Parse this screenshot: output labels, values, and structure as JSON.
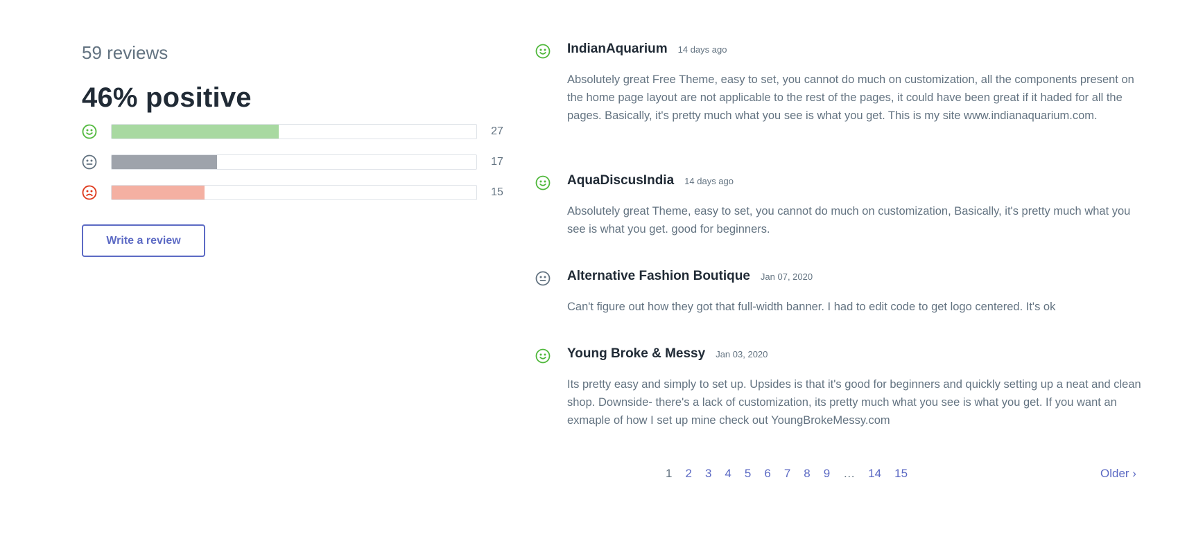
{
  "summary": {
    "review_count": "59 reviews",
    "positive_label": "46% positive",
    "ratings": [
      {
        "sentiment": "positive",
        "icon": "smile-face-icon",
        "count": "27",
        "fraction": 0.4576,
        "color": "#a8d9a1",
        "icon_color": "#50b83c"
      },
      {
        "sentiment": "neutral",
        "icon": "neutral-face-icon",
        "count": "17",
        "fraction": 0.2881,
        "color": "#9ea3ab",
        "icon_color": "#637381"
      },
      {
        "sentiment": "negative",
        "icon": "frown-face-icon",
        "count": "15",
        "fraction": 0.2542,
        "color": "#f4b0a2",
        "icon_color": "#de3618"
      }
    ],
    "write_review_label": "Write a review"
  },
  "reviews": [
    {
      "sentiment": "positive",
      "icon": "smile-face-icon",
      "author": "IndianAquarium",
      "date": "14 days ago",
      "body": "Absolutely great Free Theme, easy to set, you cannot do much on customization, all the components present on the home page layout are not applicable to the rest of the pages, it could have been great if it haded for all the pages. Basically, it's pretty much what you see is what you get. This is my site www.indianaquarium.com."
    },
    {
      "sentiment": "positive",
      "icon": "smile-face-icon",
      "author": "AquaDiscusIndia",
      "date": "14 days ago",
      "body": "Absolutely great Theme, easy to set, you cannot do much on customization, Basically, it's pretty much what you see is what you get. good for beginners."
    },
    {
      "sentiment": "neutral",
      "icon": "neutral-face-icon",
      "author": "Alternative Fashion Boutique",
      "date": "Jan 07, 2020",
      "body": "Can't figure out how they got that full-width banner. I had to edit code to get logo centered. It's ok"
    },
    {
      "sentiment": "positive",
      "icon": "smile-face-icon",
      "author": "Young Broke & Messy",
      "date": "Jan 03, 2020",
      "body": "Its pretty easy and simply to set up. Upsides is that it's good for beginners and quickly setting up a neat and clean shop. Downside- there's a lack of customization, its pretty much what you see is what you get. If you want an exmaple of how I set up mine check out YoungBrokeMessy.com"
    }
  ],
  "pagination": {
    "pages": [
      "1",
      "2",
      "3",
      "4",
      "5",
      "6",
      "7",
      "8",
      "9",
      "…",
      "14",
      "15"
    ],
    "current": "1",
    "older_label": "Older ›"
  },
  "colors": {
    "accent": "#5c6ac4",
    "positive": "#50b83c",
    "neutral": "#637381",
    "negative": "#de3618"
  }
}
